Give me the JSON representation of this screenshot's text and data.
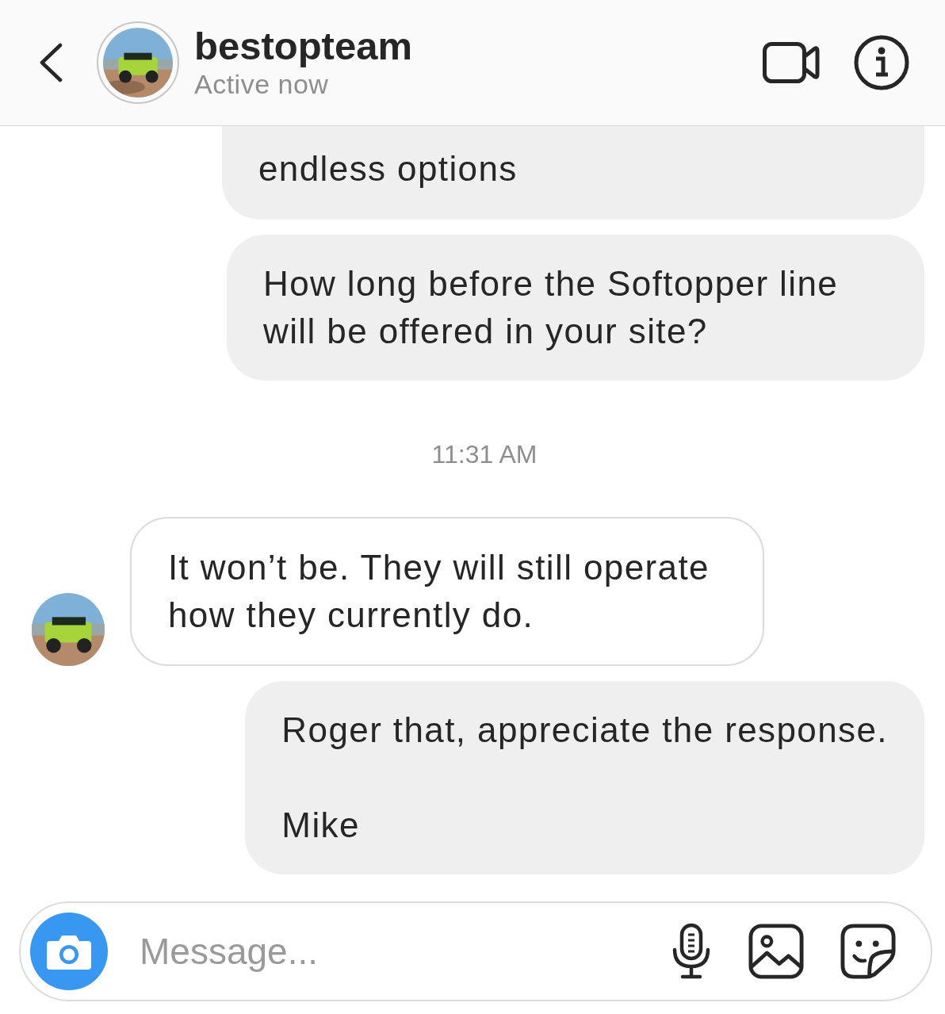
{
  "header": {
    "title": "bestopteam",
    "status": "Active now"
  },
  "messages": [
    {
      "kind": "sent",
      "clipped": true,
      "text": "endless options"
    },
    {
      "kind": "sent",
      "clipped": false,
      "text": "How long before the Softopper line will be offered in your site?"
    },
    {
      "kind": "time",
      "text": "11:31 AM"
    },
    {
      "kind": "received",
      "text": "It won’t be. They will still operate how they currently do."
    },
    {
      "kind": "sent",
      "clipped": false,
      "text": "Roger that, appreciate the response.\n\nMike"
    }
  ],
  "composer": {
    "placeholder": "Message..."
  }
}
